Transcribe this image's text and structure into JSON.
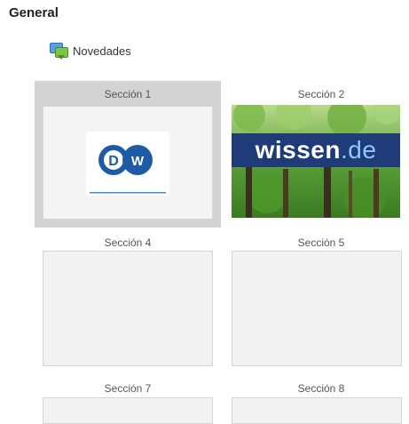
{
  "page": {
    "title": "General"
  },
  "news": {
    "label": "Novedades",
    "icon": "forum-icon"
  },
  "sections": [
    {
      "label": "Sección 1",
      "image": "dw-logo",
      "selected": true
    },
    {
      "label": "Sección 2",
      "image": "wissen.de",
      "selected": false
    },
    {
      "label": "Sección 4",
      "image": "",
      "selected": false
    },
    {
      "label": "Sección 5",
      "image": "",
      "selected": false
    },
    {
      "label": "Sección 7",
      "image": "",
      "selected": false
    },
    {
      "label": "Sección 8",
      "image": "",
      "selected": false
    }
  ],
  "wissen_logo": {
    "main": "wissen",
    "suffix": ".de"
  },
  "colors": {
    "selected_bg": "#d3d3d3",
    "tile_bg": "#f2f2f2",
    "dw_blue": "#1f5aa6"
  }
}
